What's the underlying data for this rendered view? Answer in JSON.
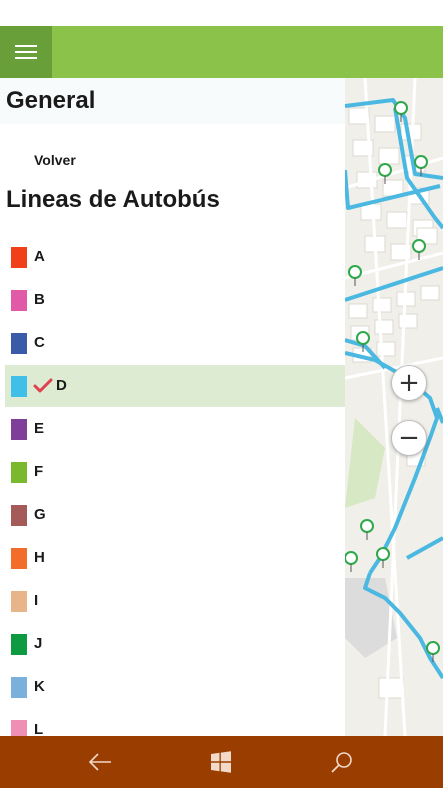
{
  "sections": {
    "general_title": "General",
    "back_label": "Volver",
    "lines_title": "Lineas de Autobús"
  },
  "lines": [
    {
      "label": "A",
      "color": "#f0401a",
      "selected": false
    },
    {
      "label": "B",
      "color": "#e05aa8",
      "selected": false
    },
    {
      "label": "C",
      "color": "#3a5ba8",
      "selected": false
    },
    {
      "label": "D",
      "color": "#40c0e8",
      "selected": true
    },
    {
      "label": "E",
      "color": "#7f3f98",
      "selected": false
    },
    {
      "label": "F",
      "color": "#7ab92e",
      "selected": false
    },
    {
      "label": "G",
      "color": "#a55a5a",
      "selected": false
    },
    {
      "label": "H",
      "color": "#f26c2a",
      "selected": false
    },
    {
      "label": "I",
      "color": "#e8b48a",
      "selected": false
    },
    {
      "label": "J",
      "color": "#0e9a40",
      "selected": false
    },
    {
      "label": "K",
      "color": "#7ab0dc",
      "selected": false
    },
    {
      "label": "L",
      "color": "#ef8fb4",
      "selected": false
    }
  ],
  "colors": {
    "appbar": "#8bc34a",
    "appbar_menu": "#689f38",
    "navbar": "#993d00",
    "selected_row": "#dcebd1",
    "checkmark": "#e04050",
    "route": "#4ab8e0",
    "bus_stop": "#2ea84a"
  },
  "icons": {
    "menu": "hamburger-icon",
    "check": "checkmark-icon",
    "zoom_in": "plus-icon",
    "zoom_out": "minus-icon",
    "back": "back-arrow-icon",
    "home": "windows-logo-icon",
    "search": "search-icon"
  }
}
